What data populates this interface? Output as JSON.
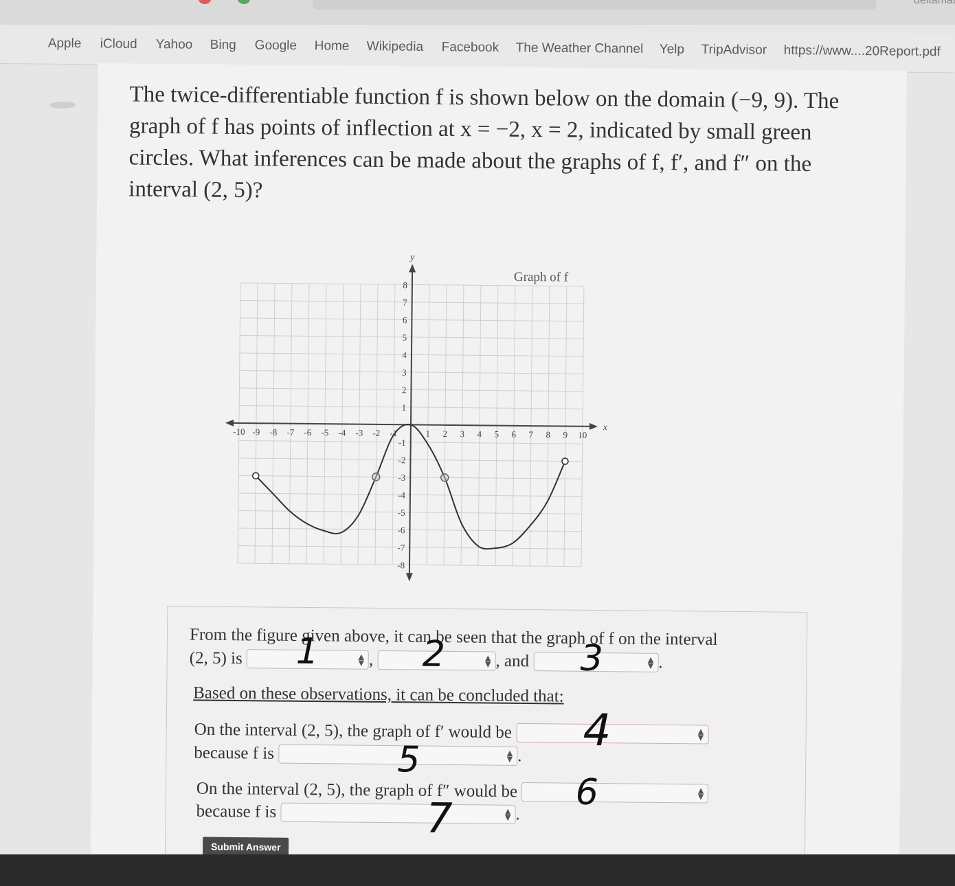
{
  "browser": {
    "url": "deltamath.com",
    "bookmarks": [
      "Apple",
      "iCloud",
      "Yahoo",
      "Bing",
      "Google",
      "Home",
      "Wikipedia",
      "Facebook",
      "The Weather Channel",
      "Yelp",
      "TripAdvisor",
      "https://www....20Report.pdf"
    ]
  },
  "question": {
    "text": "The twice-differentiable function f is shown below on the domain (−9, 9). The graph of f has points of inflection at x = −2, x = 2, indicated by small green circles. What inferences can be made about the graphs of f, f′, and f″ on the interval (2, 5)?"
  },
  "chart_data": {
    "type": "line",
    "title": "Graph of f",
    "xlabel": "x",
    "ylabel": "y",
    "xlim": [
      -10,
      10
    ],
    "ylim": [
      -8,
      8
    ],
    "x_ticks": [
      "-10",
      "-9",
      "-8",
      "-7",
      "-6",
      "-5",
      "-4",
      "-3",
      "-2",
      "-1",
      "1",
      "2",
      "3",
      "4",
      "5",
      "6",
      "7",
      "8",
      "9",
      "10"
    ],
    "y_ticks": [
      "8",
      "7",
      "6",
      "5",
      "4",
      "3",
      "2",
      "1",
      "-1",
      "-2",
      "-3",
      "-4",
      "-5",
      "-6",
      "-7",
      "-8"
    ],
    "series": [
      {
        "x": [
          -9,
          -8,
          -7,
          -6,
          -5,
          -4,
          -3,
          -2,
          -1,
          0,
          1,
          2,
          3,
          4,
          5,
          6,
          7,
          8,
          9
        ],
        "y": [
          -3,
          -4,
          -5,
          -5.7,
          -6.1,
          -6.2,
          -5.2,
          -3,
          -0.6,
          0,
          -1.1,
          -3,
          -5.6,
          -6.9,
          -7,
          -6.7,
          -5.7,
          -4.3,
          -2
        ]
      }
    ],
    "open_endpoints": [
      [
        -9,
        -3
      ],
      [
        9,
        -2
      ]
    ],
    "inflection_points": [
      [
        -2,
        -3
      ],
      [
        2,
        -3
      ]
    ],
    "grid": true
  },
  "form": {
    "line1_text": "From the figure given above, it can be seen that the graph of f on the interval",
    "line1b_prefix": "(2, 5) is",
    "comma": ",",
    "and_text": ", and",
    "period": ".",
    "conclusion_label": "Based on these observations, it can be concluded that:",
    "fprime_text": "On the interval (2, 5), the graph of f′ would be",
    "fprime_because": "because f is",
    "fdouble_text": "On the interval (2, 5), the graph of f″ would be",
    "fdouble_because": "because f is",
    "submit_label": "Submit Answer"
  },
  "handwritten": [
    "1",
    "2",
    "3",
    "4",
    "5",
    "6",
    "7"
  ]
}
